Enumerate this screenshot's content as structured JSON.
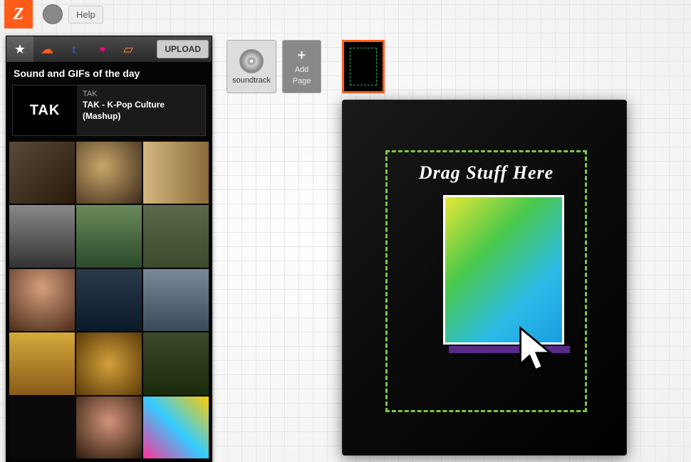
{
  "topbar": {
    "logo_letter": "Z",
    "help_label": "Help"
  },
  "sidebar": {
    "upload_label": "UPLOAD",
    "section_title": "Sound and GIFs of the day",
    "media": {
      "thumb_text": "TAK",
      "artist": "TAK",
      "title": "TAK - K-Pop Culture (Mashup)"
    },
    "tabs": [
      {
        "name": "favorites",
        "glyph": "★",
        "color": "#fff"
      },
      {
        "name": "soundcloud",
        "glyph": "☁",
        "color": "#ff5c1a"
      },
      {
        "name": "tumblr",
        "glyph": "t",
        "color": "#3b5998"
      },
      {
        "name": "flickr",
        "glyph": "••",
        "color": "#ff0084"
      },
      {
        "name": "page",
        "glyph": "▱",
        "color": "#ff8c42"
      }
    ]
  },
  "toolbar": {
    "soundtrack_label": "soundtrack",
    "add_plus": "+",
    "add_page_label": "Add",
    "add_page_label2": "Page"
  },
  "canvas": {
    "drop_text": "Drag Stuff Here"
  }
}
